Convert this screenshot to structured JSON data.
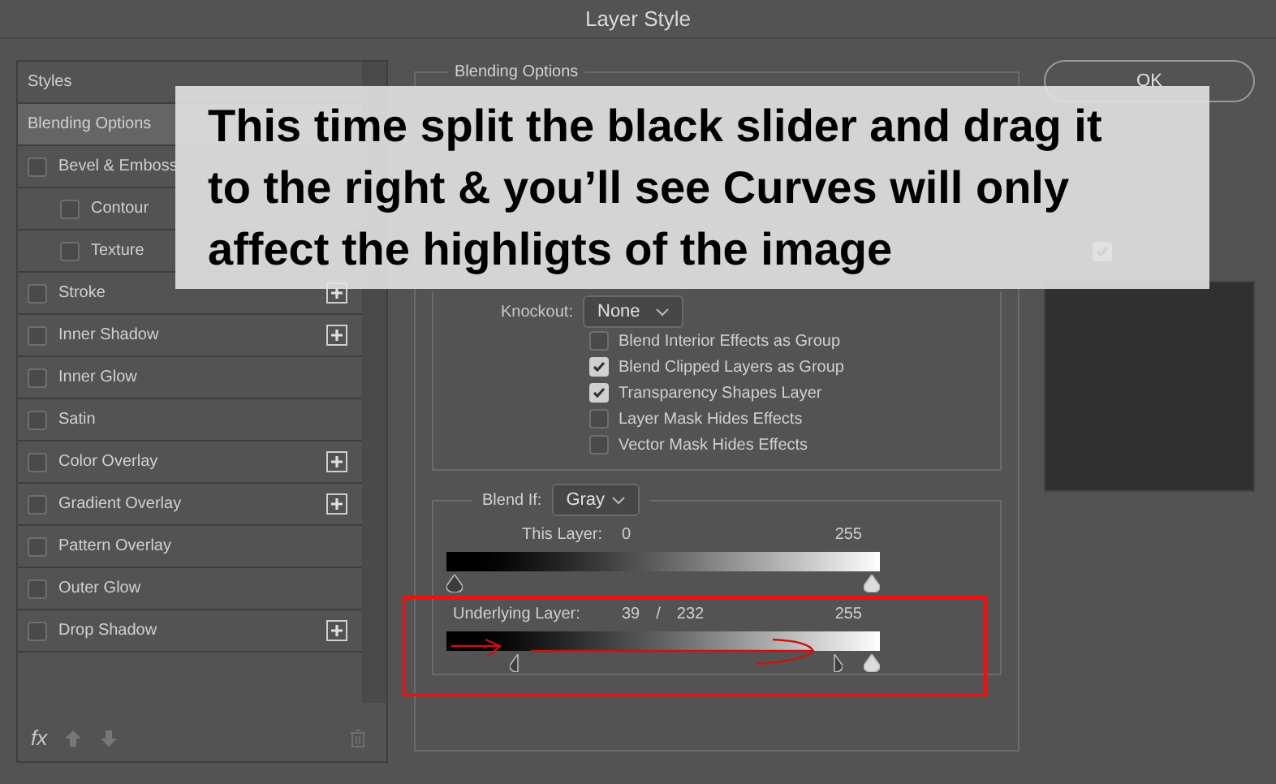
{
  "window": {
    "title": "Layer Style"
  },
  "styles_panel": {
    "header": "Styles",
    "items": [
      {
        "label": "Blending Options",
        "kind": "plain",
        "selected": true
      },
      {
        "label": "Bevel & Emboss",
        "kind": "check",
        "checked": false,
        "selected": false,
        "add_button": false,
        "children": [
          {
            "label": "Contour",
            "kind": "check",
            "checked": false,
            "selected": false,
            "add_button": false
          },
          {
            "label": "Texture",
            "kind": "check",
            "checked": false,
            "selected": false,
            "add_button": false
          }
        ]
      },
      {
        "label": "Stroke",
        "kind": "check",
        "checked": false,
        "selected": false,
        "add_button": true
      },
      {
        "label": "Inner Shadow",
        "kind": "check",
        "checked": false,
        "selected": false,
        "add_button": true
      },
      {
        "label": "Inner Glow",
        "kind": "check",
        "checked": false,
        "selected": false,
        "add_button": false
      },
      {
        "label": "Satin",
        "kind": "check",
        "checked": false,
        "selected": false,
        "add_button": false
      },
      {
        "label": "Color Overlay",
        "kind": "check",
        "checked": false,
        "selected": false,
        "add_button": true
      },
      {
        "label": "Gradient Overlay",
        "kind": "check",
        "checked": false,
        "selected": false,
        "add_button": true
      },
      {
        "label": "Pattern Overlay",
        "kind": "check",
        "checked": false,
        "selected": false,
        "add_button": false
      },
      {
        "label": "Outer Glow",
        "kind": "check",
        "checked": false,
        "selected": false,
        "add_button": false
      },
      {
        "label": "Drop Shadow",
        "kind": "check",
        "checked": false,
        "selected": false,
        "add_button": true
      }
    ],
    "toolbar": {
      "fx": "fx"
    }
  },
  "blending_options": {
    "title": "Blending Options",
    "advanced": {
      "knockout": {
        "label": "Knockout:",
        "value": "None"
      },
      "options": [
        {
          "label": "Blend Interior Effects as Group",
          "checked": false
        },
        {
          "label": "Blend Clipped Layers as Group",
          "checked": true
        },
        {
          "label": "Transparency Shapes Layer",
          "checked": true
        },
        {
          "label": "Layer Mask Hides Effects",
          "checked": false
        },
        {
          "label": "Vector Mask Hides Effects",
          "checked": false
        }
      ]
    },
    "blend_if": {
      "label": "Blend If:",
      "value": "Gray",
      "sliders": [
        {
          "label": "This Layer:",
          "readings": [
            "0",
            "255"
          ],
          "thumbs": [
            {
              "kind": "dark",
              "level": 0
            },
            {
              "kind": "light",
              "level": 1
            }
          ]
        },
        {
          "label": "Underlying Layer:",
          "readings": [
            "39",
            "/",
            "232",
            "255"
          ],
          "thumbs": [
            {
              "kind": "dark-left",
              "level": 0.153
            },
            {
              "kind": "dark-right",
              "level": 0.91
            },
            {
              "kind": "light",
              "level": 1
            }
          ]
        }
      ]
    }
  },
  "buttons": [
    {
      "label": "OK"
    }
  ],
  "preview": {
    "checked": true
  },
  "caption": "This time split the black slider and drag it to the right & you’ll see Curves will only affect the highligts of the image"
}
